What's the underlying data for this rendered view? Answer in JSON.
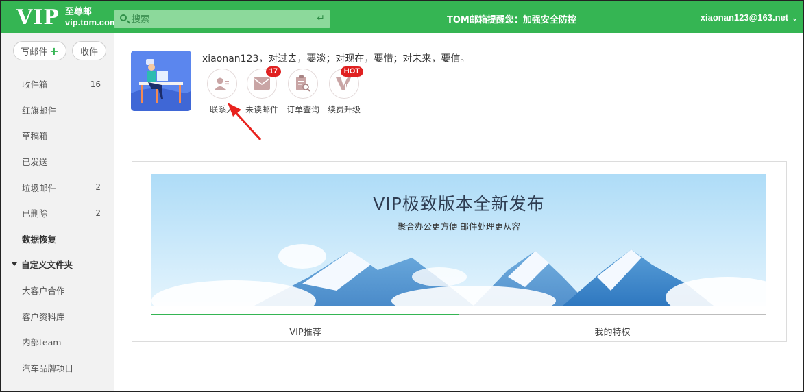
{
  "header": {
    "logo_main": "VIP",
    "logo_cn": "至尊邮",
    "logo_domain": "vip.tom.com",
    "search_placeholder": "搜索",
    "notice": "TOM邮箱提醒您：加强安全防控",
    "account": "xiaonan123@163.net",
    "brand_color": "#35b553"
  },
  "sidebar": {
    "compose_label": "写邮件",
    "receive_label": "收件",
    "items": [
      {
        "label": "收件箱",
        "count": "16"
      },
      {
        "label": "红旗邮件",
        "count": ""
      },
      {
        "label": "草稿箱",
        "count": ""
      },
      {
        "label": "已发送",
        "count": ""
      },
      {
        "label": "垃圾邮件",
        "count": "2"
      },
      {
        "label": "已删除",
        "count": "2"
      },
      {
        "label": "数据恢复",
        "count": ""
      },
      {
        "label": "自定义文件夹",
        "count": ""
      },
      {
        "label": "大客户合作",
        "count": ""
      },
      {
        "label": "客户资料库",
        "count": ""
      },
      {
        "label": "内部team",
        "count": ""
      },
      {
        "label": "汽车品牌项目",
        "count": ""
      }
    ]
  },
  "profile": {
    "greeting": "xiaonan123，对过去，要淡；对现在，要惜；对未来，要信。",
    "shortcuts": [
      {
        "label": "联系人",
        "icon": "contacts-icon",
        "badge": ""
      },
      {
        "label": "未读邮件",
        "icon": "mail-icon",
        "badge": "17"
      },
      {
        "label": "订单查询",
        "icon": "order-icon",
        "badge": ""
      },
      {
        "label": "续费升级",
        "icon": "vip-icon",
        "badge": "HOT"
      }
    ]
  },
  "banner": {
    "title": "VIP极致版本全新发布",
    "subtitle": "聚合办公更方便   邮件处理更从容",
    "tabs": [
      "VIP推荐",
      "我的特权"
    ]
  }
}
